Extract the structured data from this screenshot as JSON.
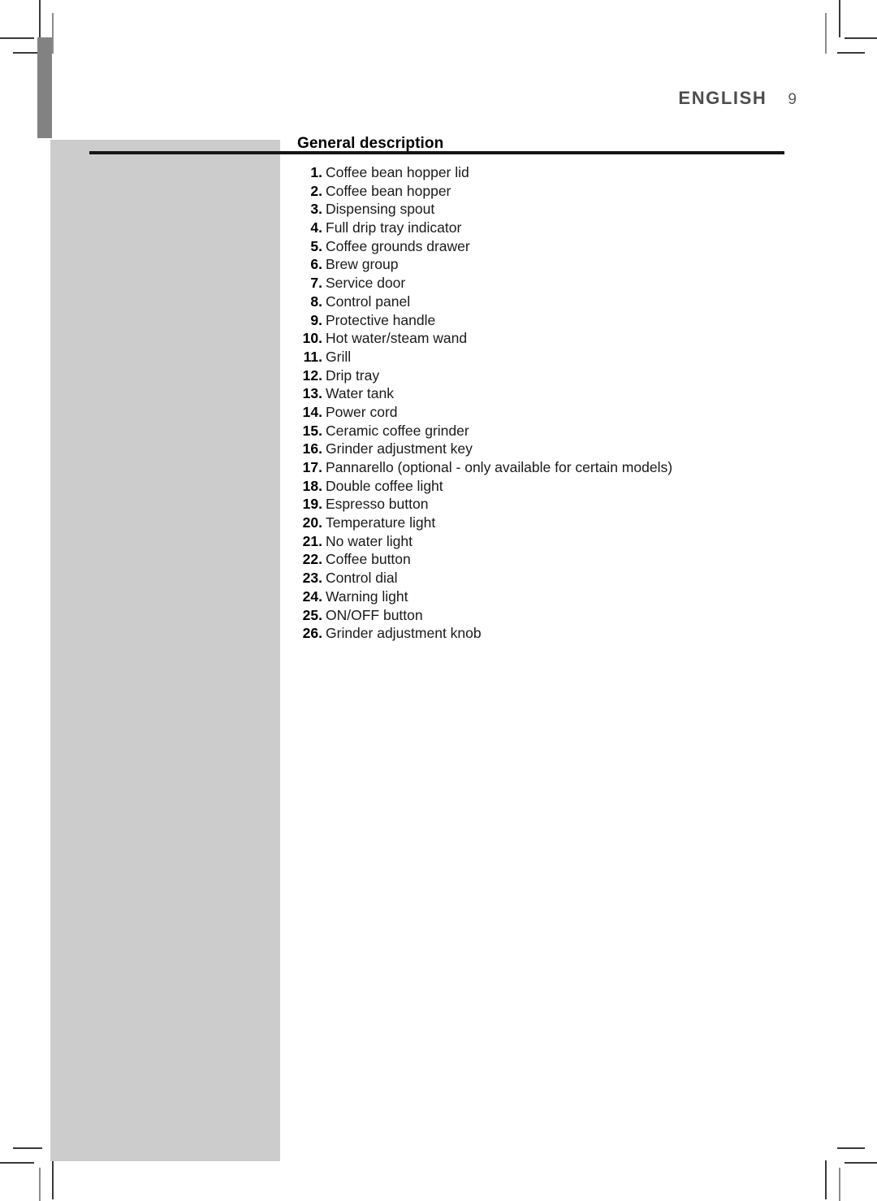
{
  "header": {
    "language": "ENGLISH",
    "page_number": "9"
  },
  "section": {
    "title": "General description"
  },
  "parts_list": [
    {
      "number": "1.",
      "label": "Coffee bean hopper lid"
    },
    {
      "number": "2.",
      "label": "Coffee bean hopper"
    },
    {
      "number": "3.",
      "label": "Dispensing spout"
    },
    {
      "number": "4.",
      "label": "Full drip tray indicator"
    },
    {
      "number": "5.",
      "label": "Coffee grounds drawer"
    },
    {
      "number": "6.",
      "label": "Brew group"
    },
    {
      "number": "7.",
      "label": "Service door"
    },
    {
      "number": "8.",
      "label": "Control panel"
    },
    {
      "number": "9.",
      "label": "Protective handle"
    },
    {
      "number": "10.",
      "label": "Hot water/steam wand"
    },
    {
      "number": "11.",
      "label": "Grill"
    },
    {
      "number": "12.",
      "label": "Drip tray"
    },
    {
      "number": "13.",
      "label": "Water tank"
    },
    {
      "number": "14.",
      "label": "Power cord"
    },
    {
      "number": "15.",
      "label": "Ceramic coffee grinder"
    },
    {
      "number": "16.",
      "label": "Grinder adjustment key"
    },
    {
      "number": "17.",
      "label": "Pannarello (optional - only available for certain models)"
    },
    {
      "number": "18.",
      "label": "Double coffee light"
    },
    {
      "number": "19.",
      "label": "Espresso button"
    },
    {
      "number": "20.",
      "label": "Temperature light"
    },
    {
      "number": "21.",
      "label": "No water light"
    },
    {
      "number": "22.",
      "label": "Coffee button"
    },
    {
      "number": "23.",
      "label": "Control dial"
    },
    {
      "number": "24.",
      "label": "Warning light"
    },
    {
      "number": "25.",
      "label": "ON/OFF button"
    },
    {
      "number": "26.",
      "label": "Grinder adjustment knob"
    }
  ],
  "colors": {
    "chapter_tab": "#828282",
    "side_panel": "#cccccc",
    "rule": "#161616",
    "header_text": "#4d4d4d"
  }
}
